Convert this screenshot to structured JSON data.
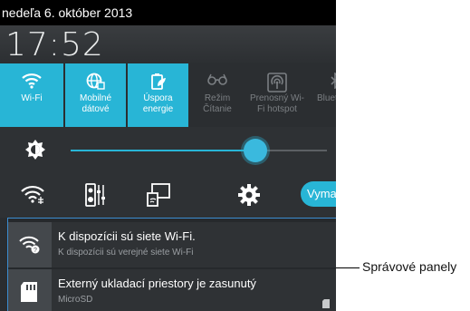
{
  "status_bar": {
    "date": "nedeľa 6. október 2013"
  },
  "clock": {
    "time": "17:52"
  },
  "quick_tiles": [
    {
      "label": "Wi-Fi",
      "icon": "wifi-icon",
      "active": true
    },
    {
      "label": "Mobilné\ndátové",
      "icon": "globe-icon",
      "active": true
    },
    {
      "label": "Úspora\nenergie",
      "icon": "battery-leaf-icon",
      "active": true
    },
    {
      "label": "Režim\nČítanie",
      "icon": "glasses-icon",
      "active": false
    },
    {
      "label": "Prenosný Wi-\nFi hotspot",
      "icon": "hotspot-icon",
      "active": false
    },
    {
      "label": "Bluet",
      "icon": "bluetooth-icon",
      "active": false
    }
  ],
  "brightness": {
    "icon": "brightness-icon",
    "level": 0.72
  },
  "tools": {
    "wifi_settings_icon": "wifi-settings-icon",
    "audio_icon": "audio-mixer-icon",
    "screen_cast_icon": "screen-cast-icon",
    "settings_icon": "gear-icon",
    "clear_label": "Vymazať"
  },
  "notifications": [
    {
      "title": "K dispozícii sú siete Wi-Fi.",
      "subtitle": "K dispozícii sú verejné siete Wi-Fi",
      "icon": "wifi-question-icon"
    },
    {
      "title": "Externý ukladací priestory je zasunutý",
      "subtitle": "MicroSD",
      "icon": "sd-card-icon"
    }
  ],
  "callout": {
    "label": "Správové panely"
  },
  "colors": {
    "accent": "#28b5d6",
    "panel_bg": "#2e3134",
    "status_bar": "#000000"
  }
}
